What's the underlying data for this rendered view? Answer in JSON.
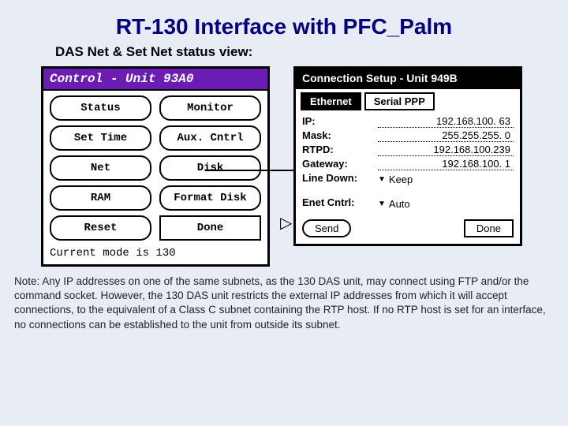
{
  "title": "RT-130 Interface with PFC_Palm",
  "subtitle": "DAS Net & Set Net status view:",
  "control_panel": {
    "titlebar": "Control - Unit 93A0",
    "buttons": {
      "status": "Status",
      "monitor": "Monitor",
      "set_time": "Set Time",
      "aux_cntrl": "Aux. Cntrl",
      "net": "Net",
      "disk": "Disk",
      "ram": "RAM",
      "format_disk": "Format Disk",
      "reset": "Reset",
      "done": "Done"
    },
    "footer": "Current mode is 130"
  },
  "connection_panel": {
    "titlebar": "Connection Setup - Unit 949B",
    "tabs": {
      "ethernet": "Ethernet",
      "serial_ppp": "Serial PPP"
    },
    "fields": {
      "ip_label": "IP:",
      "ip_value": "192.168.100. 63",
      "mask_label": "Mask:",
      "mask_value": "255.255.255.  0",
      "rtpd_label": "RTPD:",
      "rtpd_value": "192.168.100.239",
      "gateway_label": "Gateway:",
      "gateway_value": "192.168.100.  1",
      "line_down_label": "Line Down:",
      "line_down_value": "Keep",
      "enet_cntrl_label": "Enet Cntrl:",
      "enet_cntrl_value": "Auto"
    },
    "buttons": {
      "send": "Send",
      "done": "Done"
    }
  },
  "note": "Note: Any IP addresses on one of the same subnets, as the 130 DAS unit, may connect using FTP and/or the command socket. However, the 130 DAS unit restricts the external IP addresses from which it will accept connections, to the equivalent of a Class C subnet containing the RTP host. If no RTP host is set for an interface, no connections can be established to the unit from outside its subnet."
}
